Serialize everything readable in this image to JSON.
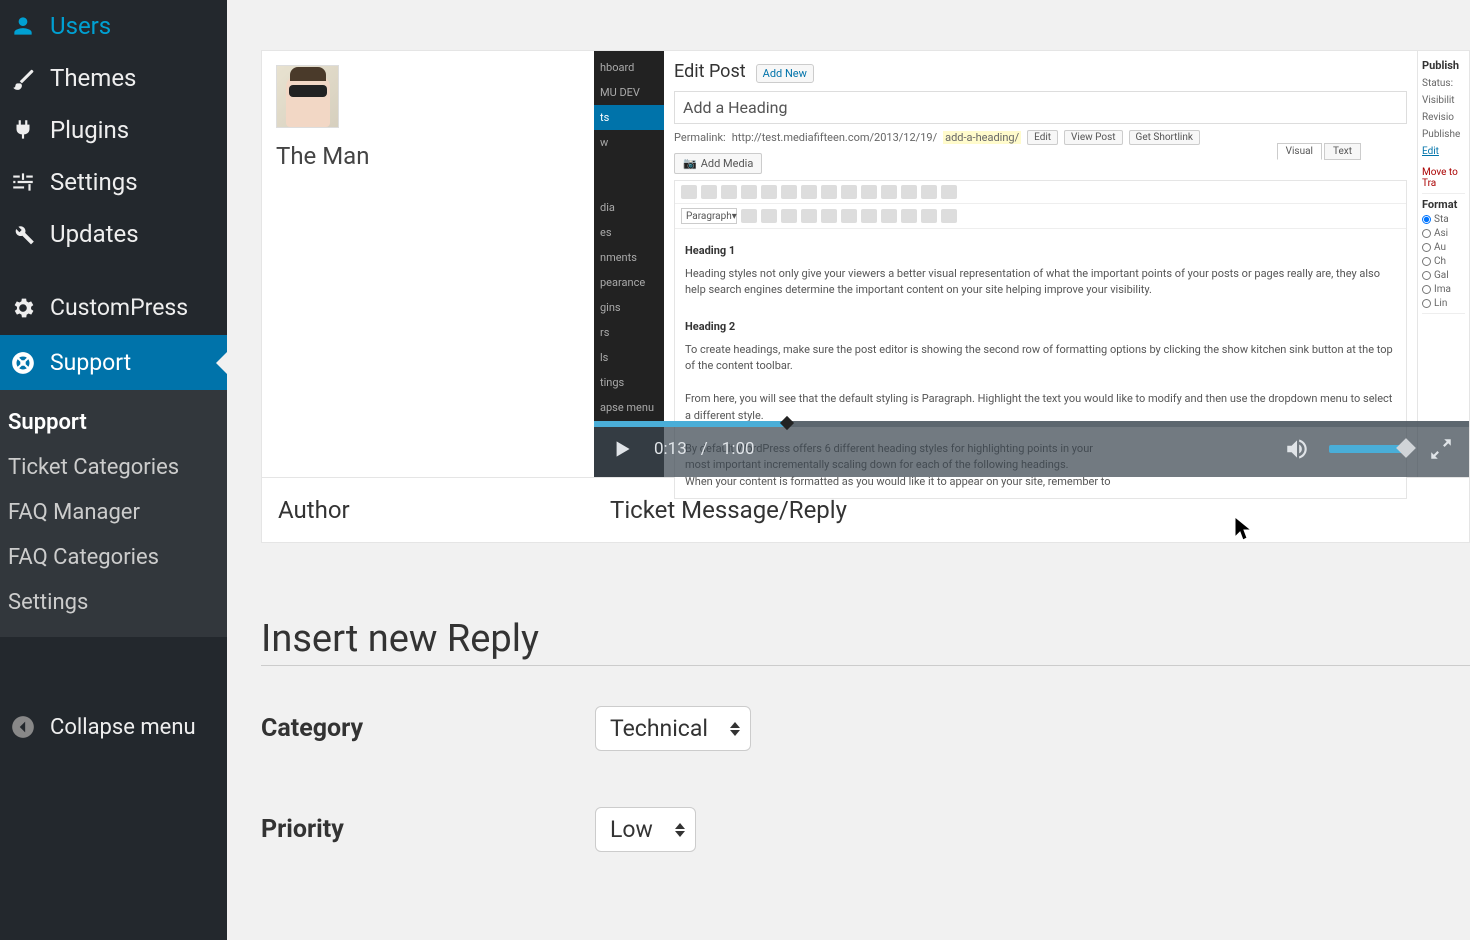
{
  "sidebar": {
    "items": [
      {
        "label": "Users",
        "icon": "users"
      },
      {
        "label": "Themes",
        "icon": "brush"
      },
      {
        "label": "Plugins",
        "icon": "plug"
      },
      {
        "label": "Settings",
        "icon": "sliders"
      },
      {
        "label": "Updates",
        "icon": "wrench"
      }
    ],
    "extra": [
      {
        "label": "CustomPress",
        "icon": "gear"
      },
      {
        "label": "Support",
        "icon": "life-ring"
      }
    ],
    "submenu": [
      "Support",
      "Ticket Categories",
      "FAQ Manager",
      "FAQ Categories",
      "Settings"
    ],
    "collapse": "Collapse menu"
  },
  "ticket": {
    "author_name": "The Man",
    "footer_author": "Author",
    "footer_message": "Ticket Message/Reply",
    "video": {
      "current": "0:13",
      "sep": "/",
      "total": "1:00",
      "editor": {
        "title": "Edit Post",
        "add_new": "Add New",
        "post_title": "Add a Heading",
        "permalink_label": "Permalink:",
        "permalink_url": "http://test.mediafifteen.com/2013/12/19/",
        "permalink_slug": "add-a-heading/",
        "btn_edit": "Edit",
        "btn_view": "View Post",
        "btn_shortlink": "Get Shortlink",
        "add_media": "Add Media",
        "paragraph": "Paragraph",
        "tabs_visual": "Visual",
        "tabs_text": "Text",
        "h1": "Heading 1",
        "p1": "Heading styles not only give your viewers a better visual representation of what the important points of your posts or pages really are, they also help search engines determine the important content on your site helping improve your visibility.",
        "h2": "Heading 2",
        "p2": "To create headings, make sure the post editor is showing the second row of formatting options by clicking the show kitchen sink button at the top of the content toolbar.",
        "p3": "From here, you will see that the default styling is Paragraph. Highlight the text you would like to modify and then use the dropdown menu to select a different style.",
        "p4": "By default WordPress offers 6 different heading styles for highlighting points in your",
        "p5": "most important incrementally scaling down for each of the following headings.",
        "p6": "When your content is formatted as you would like it to appear on your site, remember to"
      },
      "meta": {
        "publish": "Publish",
        "status": "Status:",
        "visibility": "Visibilit",
        "revision": "Revisio",
        "published": "Publishe",
        "edit": "Edit",
        "move": "Move to Tra",
        "format": "Format",
        "opts": [
          "Sta",
          "Asi",
          "Au",
          "Ch",
          "Gal",
          "Ima",
          "Lin"
        ]
      },
      "vsidebar": [
        "hboard",
        "MU DEV",
        "ts",
        "w",
        "dia",
        "es",
        "nments",
        "pearance",
        "gins",
        "rs",
        "ls",
        "tings",
        "apse menu"
      ]
    }
  },
  "reply": {
    "title": "Insert new Reply",
    "category_label": "Category",
    "category_value": "Technical",
    "priority_label": "Priority",
    "priority_value": "Low"
  }
}
